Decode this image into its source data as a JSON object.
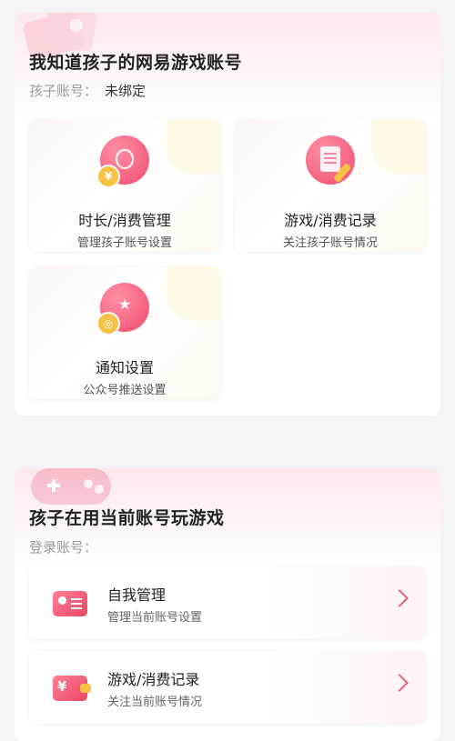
{
  "section1": {
    "title": "我知道孩子的网易游戏账号",
    "account_label": "孩子账号：",
    "account_value": "未绑定",
    "tiles": [
      {
        "name": "时长/消费管理",
        "sub": "管理孩子账号设置",
        "icon": "timer-icon"
      },
      {
        "name": "游戏/消费记录",
        "sub": "关注孩子账号情况",
        "icon": "record-icon"
      },
      {
        "name": "通知设置",
        "sub": "公众号推送设置",
        "icon": "notification-icon"
      }
    ]
  },
  "section2": {
    "title": "孩子在用当前账号玩游戏",
    "login_label": "登录账号：",
    "rows": [
      {
        "name": "自我管理",
        "sub": "管理当前账号设置",
        "icon": "id-card-icon"
      },
      {
        "name": "游戏/消费记录",
        "sub": "关注当前账号情况",
        "icon": "wallet-icon"
      }
    ]
  },
  "colors": {
    "accent": "#ea4667",
    "coin": "#f7c244",
    "background": "#f4f4f6"
  }
}
